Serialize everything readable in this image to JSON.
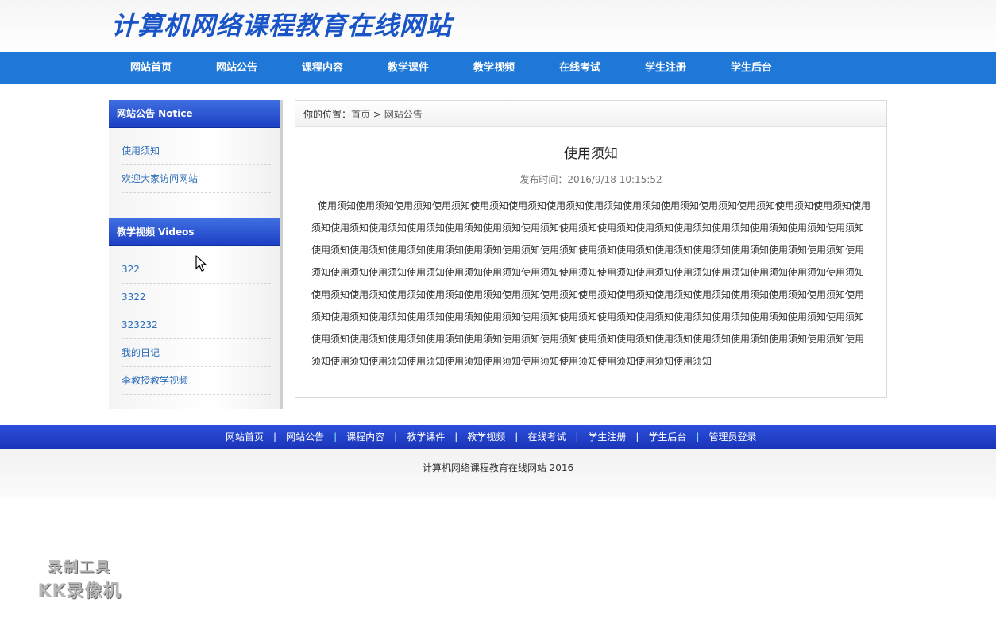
{
  "header": {
    "site_title": "计算机网络课程教育在线网站"
  },
  "nav": {
    "items": [
      "网站首页",
      "网站公告",
      "课程内容",
      "教学课件",
      "教学视频",
      "在线考试",
      "学生注册",
      "学生后台"
    ]
  },
  "sidebar": {
    "notice_title": "网站公告 Notice",
    "notice_items": [
      "使用须知",
      "欢迎大家访问网站"
    ],
    "videos_title": "教学视频 Videos",
    "video_items": [
      "322",
      "3322",
      "323232",
      "我的日记",
      "李教授教学视频"
    ]
  },
  "breadcrumb": {
    "prefix": "你的位置：",
    "home": "首页",
    "sep": ">",
    "current": "网站公告"
  },
  "article": {
    "title": "使用须知",
    "time_label": "发布时间：2016/9/18 10:15:52",
    "body": "使用须知使用须知使用须知使用须知使用须知使用须知使用须知使用须知使用须知使用须知使用须知使用须知使用须知使用须知使用须知使用须知使用须知使用须知使用须知使用须知使用须知使用须知使用须知使用须知使用须知使用须知使用须知使用须知使用须知使用须知使用须知使用须知使用须知使用须知使用须知使用须知使用须知使用须知使用须知使用须知使用须知使用须知使用须知使用须知使用须知使用须知使用须知使用须知使用须知使用须知使用须知使用须知使用须知使用须知使用须知使用须知使用须知使用须知使用须知使用须知使用须知使用须知使用须知使用须知使用须知使用须知使用须知使用须知使用须知使用须知使用须知使用须知使用须知使用须知使用须知使用须知使用须知使用须知使用须知使用须知使用须知使用须知使用须知使用须知使用须知使用须知使用须知使用须知使用须知使用须知使用须知使用须知使用须知使用须知使用须知使用须知使用须知使用须知使用须知使用须知使用须知使用须知使用须知使用须知使用须知使用须知使用须知使用须知使用须知使用须知使用须知使用须知"
  },
  "footer": {
    "links": [
      "网站首页",
      "网站公告",
      "课程内容",
      "教学课件",
      "教学视频",
      "在线考试",
      "学生注册",
      "学生后台",
      "管理员登录"
    ],
    "separator": "|",
    "copyright": "计算机网络课程教育在线网站  2016"
  },
  "watermark": {
    "line1": "录制工具",
    "line2": "KK录像机"
  },
  "colors": {
    "nav_bg": "#1f78d8",
    "side_head_bg": "#1d3fc4",
    "footer_nav_bg": "#1a34b8",
    "link": "#2a6cb8"
  }
}
